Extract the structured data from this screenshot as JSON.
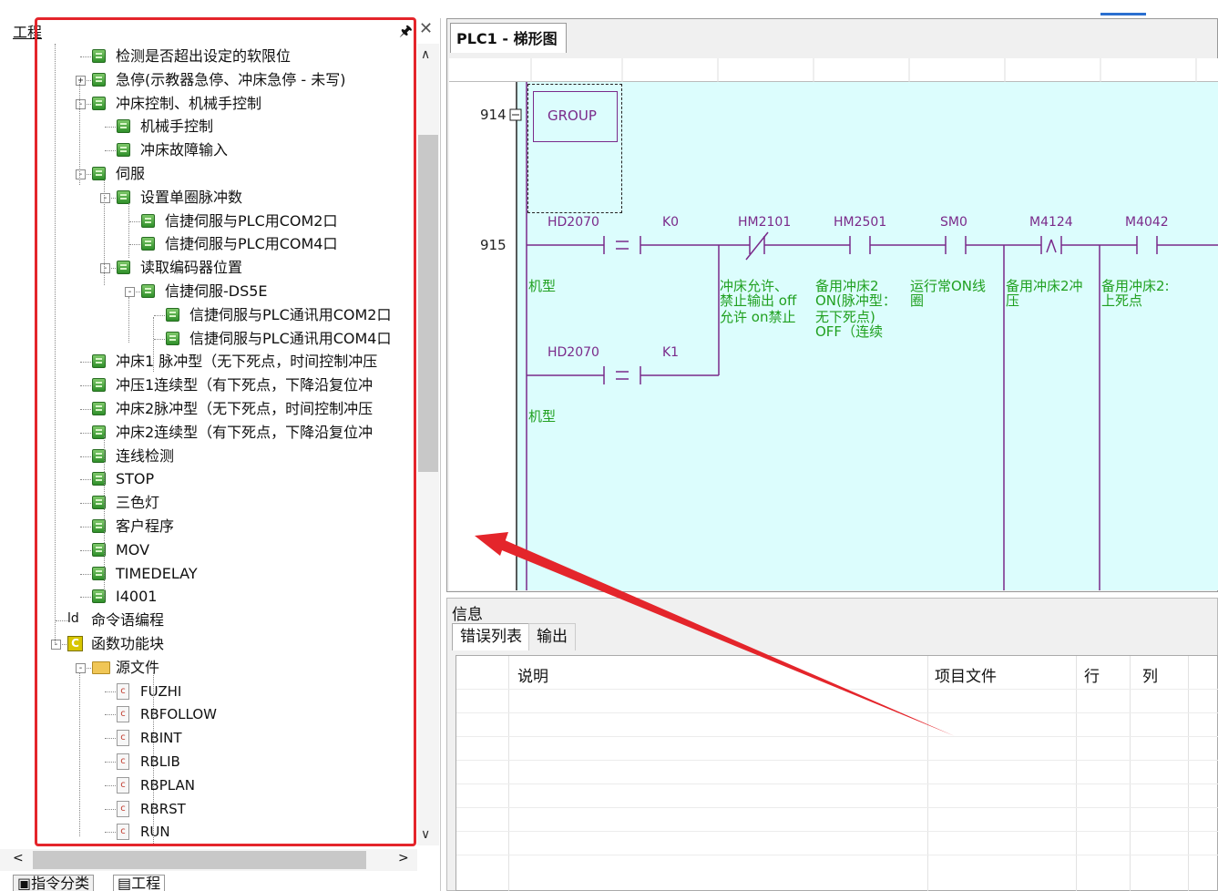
{
  "project_panel": {
    "title": "工程",
    "tree": [
      {
        "label": "检测是否超出设定的软限位",
        "indent": 1,
        "icon": "module-icon",
        "expander": ""
      },
      {
        "label": "急停(示教器急停、冲床急停 - 未写)",
        "indent": 1,
        "icon": "module-icon",
        "expander": "+"
      },
      {
        "label": "冲床控制、机械手控制",
        "indent": 1,
        "icon": "module-icon",
        "expander": "-"
      },
      {
        "label": "机械手控制",
        "indent": 2,
        "icon": "module-icon",
        "expander": ""
      },
      {
        "label": "冲床故障输入",
        "indent": 2,
        "icon": "module-icon",
        "expander": ""
      },
      {
        "label": "伺服",
        "indent": 1,
        "icon": "module-icon",
        "expander": "-"
      },
      {
        "label": "设置单圈脉冲数",
        "indent": 2,
        "icon": "module-icon",
        "expander": "-"
      },
      {
        "label": "信捷伺服与PLC用COM2口",
        "indent": 3,
        "icon": "module-icon",
        "expander": ""
      },
      {
        "label": "信捷伺服与PLC用COM4口",
        "indent": 3,
        "icon": "module-icon",
        "expander": ""
      },
      {
        "label": "读取编码器位置",
        "indent": 2,
        "icon": "module-icon",
        "expander": "-"
      },
      {
        "label": "信捷伺服-DS5E",
        "indent": 3,
        "icon": "module-icon",
        "expander": "-"
      },
      {
        "label": "信捷伺服与PLC通讯用COM2口",
        "indent": 4,
        "icon": "module-icon",
        "expander": ""
      },
      {
        "label": "信捷伺服与PLC通讯用COM4口",
        "indent": 4,
        "icon": "module-icon",
        "expander": ""
      },
      {
        "label": "冲床1 脉冲型（无下死点，时间控制冲压",
        "indent": 1,
        "icon": "module-icon",
        "expander": ""
      },
      {
        "label": "冲压1连续型（有下死点，下降沿复位冲",
        "indent": 1,
        "icon": "module-icon",
        "expander": ""
      },
      {
        "label": "冲床2脉冲型（无下死点，时间控制冲压",
        "indent": 1,
        "icon": "module-icon",
        "expander": ""
      },
      {
        "label": "冲床2连续型（有下死点，下降沿复位冲",
        "indent": 1,
        "icon": "module-icon",
        "expander": ""
      },
      {
        "label": "连线检测",
        "indent": 1,
        "icon": "module-icon",
        "expander": ""
      },
      {
        "label": "STOP",
        "indent": 1,
        "icon": "module-icon",
        "expander": ""
      },
      {
        "label": "三色灯",
        "indent": 1,
        "icon": "module-icon",
        "expander": ""
      },
      {
        "label": "客户程序",
        "indent": 1,
        "icon": "module-icon",
        "expander": ""
      },
      {
        "label": "MOV",
        "indent": 1,
        "icon": "module-icon",
        "expander": ""
      },
      {
        "label": "TIMEDELAY",
        "indent": 1,
        "icon": "module-icon",
        "expander": ""
      },
      {
        "label": "I4001",
        "indent": 1,
        "icon": "module-icon",
        "expander": ""
      },
      {
        "label": "命令语编程",
        "indent": 0,
        "icon": "ld-icon",
        "expander": ""
      },
      {
        "label": "函数功能块",
        "indent": 0,
        "icon": "function-block-icon",
        "expander": "-"
      },
      {
        "label": "源文件",
        "indent": 1,
        "icon": "folder-icon",
        "expander": "-"
      },
      {
        "label": "FUZHI",
        "indent": 2,
        "icon": "c-file-icon",
        "expander": ""
      },
      {
        "label": "RBFOLLOW",
        "indent": 2,
        "icon": "c-file-icon",
        "expander": ""
      },
      {
        "label": "RBINT",
        "indent": 2,
        "icon": "c-file-icon",
        "expander": ""
      },
      {
        "label": "RBLIB",
        "indent": 2,
        "icon": "c-file-icon",
        "expander": ""
      },
      {
        "label": "RBPLAN",
        "indent": 2,
        "icon": "c-file-icon",
        "expander": ""
      },
      {
        "label": "RBRST",
        "indent": 2,
        "icon": "c-file-icon",
        "expander": ""
      },
      {
        "label": "RUN",
        "indent": 2,
        "icon": "c-file-icon",
        "expander": ""
      }
    ],
    "bottom_tabs": [
      "指令分类",
      "工程"
    ]
  },
  "ladder": {
    "tab_title": "PLC1 - 梯形图",
    "rung_914": "914",
    "rung_915": "915",
    "group_label": "GROUP",
    "contacts": [
      {
        "label": "HD2070",
        "symbol": "="
      },
      {
        "label": "K0"
      },
      {
        "label": "HM2101"
      },
      {
        "label": "HM2501"
      },
      {
        "label": "SM0"
      },
      {
        "label": "M4124"
      },
      {
        "label": "M4042"
      },
      {
        "label": "HD2070"
      },
      {
        "label": "K1"
      }
    ],
    "comments": {
      "c1": "机型",
      "c2a": "冲床允许、",
      "c2b": "禁止输出 off",
      "c2c": "允许 on禁止",
      "c3a": "备用冲床2",
      "c3b": "ON(脉冲型：",
      "c3c": "无下死点)",
      "c3d": "OFF（连续",
      "c4a": "运行常ON线",
      "c4b": "圈",
      "c5a": "备用冲床2冲",
      "c5b": "压",
      "c6a": "备用冲床2:",
      "c6b": "上死点",
      "c7": "机型"
    }
  },
  "info": {
    "title": "信息",
    "tabs": [
      "错误列表",
      "输出"
    ],
    "columns": [
      "说明",
      "项目文件",
      "行",
      "列"
    ]
  },
  "colors": {
    "highlight": "#e4252b",
    "ladder_bg": "#dcfdfd",
    "comment": "#20a020",
    "label": "#7a2a8a"
  }
}
